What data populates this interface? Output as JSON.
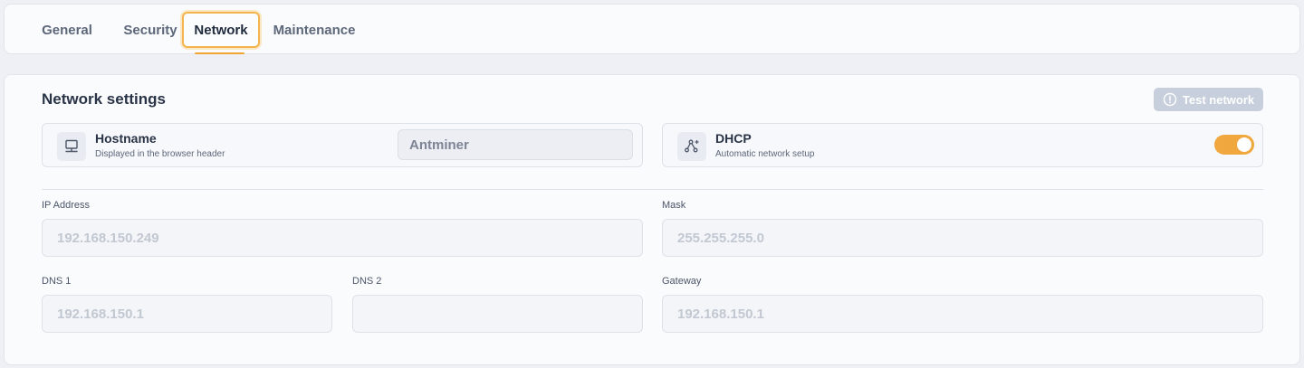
{
  "tabs": [
    {
      "label": "General",
      "active": false
    },
    {
      "label": "Security",
      "active": false
    },
    {
      "label": "Network",
      "active": true
    },
    {
      "label": "Maintenance",
      "active": false
    }
  ],
  "section": {
    "title": "Network settings",
    "test_button_label": "Test network",
    "test_button_icon": "info-icon"
  },
  "hostname": {
    "icon": "computer-icon",
    "label": "Hostname",
    "description": "Displayed in the browser header",
    "value": "Antminer"
  },
  "dhcp": {
    "icon": "network-nodes-icon",
    "label": "DHCP",
    "description": "Automatic network setup",
    "enabled": true
  },
  "fields": {
    "ip_address": {
      "label": "IP Address",
      "value": "192.168.150.249"
    },
    "mask": {
      "label": "Mask",
      "value": "255.255.255.0"
    },
    "dns1": {
      "label": "DNS 1",
      "value": "192.168.150.1"
    },
    "dns2": {
      "label": "DNS 2",
      "value": ""
    },
    "gateway": {
      "label": "Gateway",
      "value": "192.168.150.1"
    }
  },
  "colors": {
    "accent": "#f0a73e",
    "active_tab_border": "#f3b44f",
    "disabled_button": "#c6cfdb"
  }
}
